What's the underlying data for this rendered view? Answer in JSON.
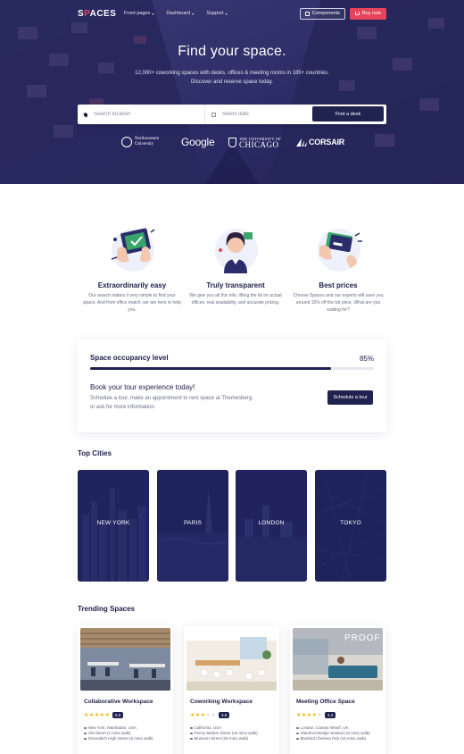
{
  "nav": {
    "logo_prefix": "S",
    "logo_mark": "P",
    "logo_suffix": "ACES",
    "links": [
      "Front pages",
      "Dashboard",
      "Support"
    ],
    "components_label": "Components",
    "buy_label": "Buy now"
  },
  "hero": {
    "title": "Find your space.",
    "subtitle": "12,000+ coworking spaces with desks, offices & meeting rooms in 185+ countries. Discover and reserve space today."
  },
  "search": {
    "location_placeholder": "Search location",
    "date_placeholder": "Select date",
    "button_label": "Find a desk"
  },
  "partners": {
    "northwestern_line1": "Northwestern",
    "northwestern_line2": "University",
    "google": "Google",
    "chicago_line1": "THE UNIVERSITY OF",
    "chicago_line2": "CHICAGO",
    "corsair": "CORSAIR"
  },
  "features": [
    {
      "title": "Extraordinarily easy",
      "text": "Our search makes it very simple to find your space. And from office match, we are here to help you."
    },
    {
      "title": "Truly transparent",
      "text": "We give you all this info, lifting the lid on actual offices, real availability, and accurate pricing."
    },
    {
      "title": "Best prices",
      "text": "Choose Spaces and our experts will save you around 15% off the list price. What are you waiting for?"
    }
  ],
  "occupancy": {
    "title": "Space occupancy level",
    "percent_label": "85%",
    "percent": 85,
    "tour_title": "Book your tour experience today!",
    "tour_text": "Schedule a tour, make an appointment to rent space at Themesberg, or ask for more information.",
    "tour_button": "Schedule a tour"
  },
  "top_cities": {
    "title": "Top Cities",
    "cities": [
      "NEW YORK",
      "PARIS",
      "LONDON",
      "TOKYO"
    ]
  },
  "trending": {
    "title": "Trending Spaces",
    "spaces": [
      {
        "title": "Collaborative Workspace",
        "stars": 5,
        "rating": "5.0",
        "meta": [
          "New York, Manhattan, USA",
          "Old Street (2 mins walk)",
          "Shoreditch High Street (6 mins walk)"
        ]
      },
      {
        "title": "Coworking Workspace",
        "stars": 3,
        "rating": "3.8",
        "meta": [
          "California, USA",
          "Penny Market Street (15 mins walk)",
          "Museum Street (28 mins walk)"
        ]
      },
      {
        "title": "Meeting Office Space",
        "stars": 4,
        "rating": "4.4",
        "meta": [
          "London, Canary Wharf, UK",
          "Stamford Bridge Stadium (5 mins walk)",
          "Bluebird Chelsea Pub (15 mins walk)"
        ]
      }
    ]
  },
  "colors": {
    "primary": "#20224f",
    "accent": "#e8435b",
    "star": "#f6b500"
  }
}
